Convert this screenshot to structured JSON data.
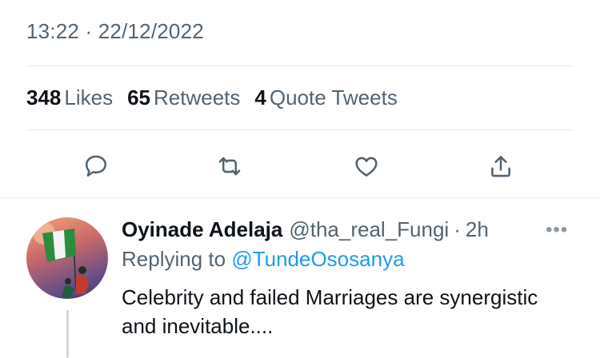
{
  "tweet": {
    "timestamp": "13:22 · 22/12/2022",
    "stats": {
      "likes_count": "348",
      "likes_label": "Likes",
      "retweets_count": "65",
      "retweets_label": "Retweets",
      "quotes_count": "4",
      "quotes_label": "Quote Tweets"
    },
    "actions": {
      "reply_icon": "reply-icon",
      "retweet_icon": "retweet-icon",
      "like_icon": "heart-icon",
      "share_icon": "share-icon"
    }
  },
  "reply": {
    "display_name": "Oyinade Adelaja",
    "handle": "@tha_real_Fungi",
    "separator": "·",
    "time": "2h",
    "more": "•••",
    "replying_prefix": "Replying to",
    "replying_mention": "@TundeOsosanya",
    "text": "Celebrity and  failed Marriages are synergistic and inevitable...."
  },
  "colors": {
    "muted": "#536471",
    "link": "#1d9bf0",
    "text": "#0f1419",
    "divider": "#e6ecf0"
  }
}
